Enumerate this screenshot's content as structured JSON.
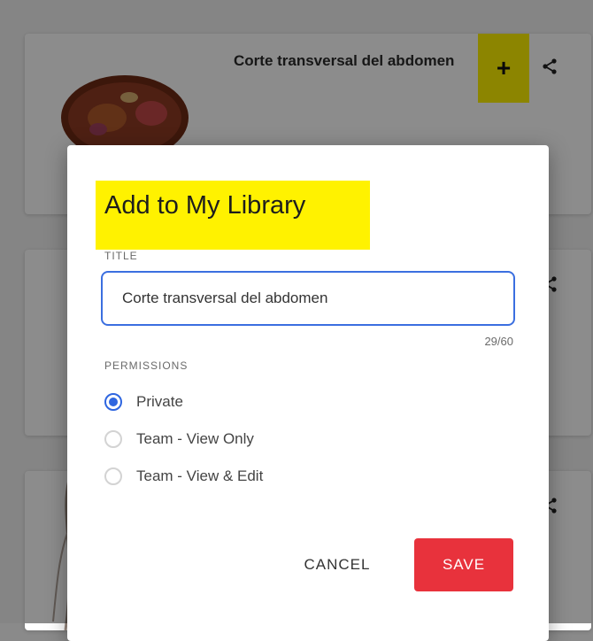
{
  "list": {
    "items": [
      {
        "title": "Corte transversal del abdomen",
        "add_icon": "plus-icon",
        "share_icon": "share-icon"
      },
      {
        "share_icon": "share-icon"
      },
      {
        "share_icon": "share-icon"
      }
    ]
  },
  "dialog": {
    "title": "Add to My Library",
    "title_field": {
      "label": "TITLE",
      "value": "Corte transversal del abdomen",
      "count": "29/60"
    },
    "permissions": {
      "label": "PERMISSIONS",
      "options": [
        {
          "label": "Private",
          "selected": true
        },
        {
          "label": "Team - View Only",
          "selected": false
        },
        {
          "label": "Team - View & Edit",
          "selected": false
        }
      ]
    },
    "cancel_label": "CANCEL",
    "save_label": "SAVE"
  },
  "colors": {
    "highlight": "#fff200",
    "accent_blue": "#2f66e0",
    "save_red": "#e8323c"
  }
}
